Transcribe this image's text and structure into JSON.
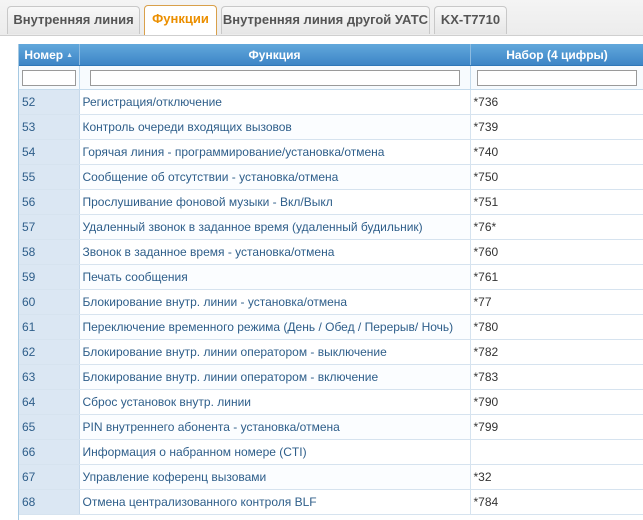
{
  "tabs": [
    {
      "label": "Внутренняя линия",
      "active": false
    },
    {
      "label": "Функции",
      "active": true
    },
    {
      "label": "Внутренняя линия другой УАТС",
      "active": false
    },
    {
      "label": "KX-T7710",
      "active": false
    }
  ],
  "table": {
    "columns": [
      "Номер",
      "Функция",
      "Набор (4 цифры)"
    ],
    "rows": [
      [
        "52",
        "Регистрация/отключение",
        "*736"
      ],
      [
        "53",
        "Контроль очереди входящих вызовов",
        "*739"
      ],
      [
        "54",
        "Горячая линия - программирование/установка/отмена",
        "*740"
      ],
      [
        "55",
        "Сообщение об отсутствии - установка/отмена",
        "*750"
      ],
      [
        "56",
        "Прослушивание фоновой музыки - Вкл/Выкл",
        "*751"
      ],
      [
        "57",
        "Удаленный звонок в заданное время (удаленный будильник)",
        "*76*"
      ],
      [
        "58",
        "Звонок в заданное время - установка/отмена",
        "*760"
      ],
      [
        "59",
        "Печать сообщения",
        "*761"
      ],
      [
        "60",
        "Блокирование внутр. линии - установка/отмена",
        "*77"
      ],
      [
        "61",
        "Переключение временного режима (День / Обед / Перерыв/ Ночь)",
        "*780"
      ],
      [
        "62",
        "Блокирование внутр. линии оператором - выключение",
        "*782"
      ],
      [
        "63",
        "Блокирование внутр. линии оператором - включение",
        "*783"
      ],
      [
        "64",
        "Сброс установок внутр. линии",
        "*790"
      ],
      [
        "65",
        "PIN внутреннего абонента - установка/отмена",
        "*799"
      ],
      [
        "66",
        "Информация о набранном номере (CTI)",
        ""
      ],
      [
        "67",
        "Управление коференц вызовами",
        "*32"
      ],
      [
        "68",
        "Отмена централизованного контроля BLF",
        "*784"
      ]
    ]
  },
  "icons": {
    "sort": "sort-asc-icon"
  }
}
